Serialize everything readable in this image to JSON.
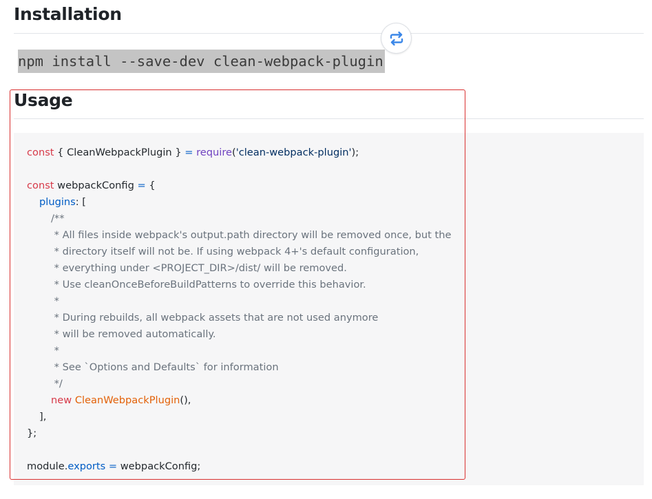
{
  "installation": {
    "heading": "Installation",
    "command": "npm install --save-dev clean-webpack-plugin"
  },
  "swap_button": {
    "icon": "swap-arrows-icon",
    "color": "#3b87e8"
  },
  "usage": {
    "heading": "Usage"
  },
  "code": {
    "l1": {
      "kw": "const",
      "a": " { CleanWebpackPlugin } ",
      "op": "=",
      "sp": " ",
      "fn": "require",
      "p1": "(",
      "str": "'clean-webpack-plugin'",
      "p2": ");"
    },
    "l2": {
      "kw": "const",
      "a": " webpackConfig ",
      "op": "=",
      "b": " {"
    },
    "l3": {
      "prop": "plugins",
      "a": ": ["
    },
    "comment": [
      "/**",
      " * All files inside webpack's output.path directory will be removed once, but the",
      " * directory itself will not be. If using webpack 4+'s default configuration,",
      " * everything under <PROJECT_DIR>/dist/ will be removed.",
      " * Use cleanOnceBeforeBuildPatterns to override this behavior.",
      " *",
      " * During rebuilds, all webpack assets that are not used anymore",
      " * will be removed automatically.",
      " *",
      " * See `Options and Defaults` for information",
      " */"
    ],
    "l4": {
      "kw": "new",
      "sp": " ",
      "cls": "CleanWebpackPlugin",
      "a": "(),"
    },
    "l5": "],",
    "l6": "};",
    "l7": {
      "a": "module.",
      "prop": "exports",
      "sp": " ",
      "op": "=",
      "b": " webpackConfig;"
    }
  },
  "colors": {
    "highlight_border": "#d93030",
    "keyword": "#d73a49",
    "function": "#6f42c1",
    "string": "#032f62",
    "property": "#005cc5",
    "comment": "#6a737d",
    "class": "#e36209"
  }
}
